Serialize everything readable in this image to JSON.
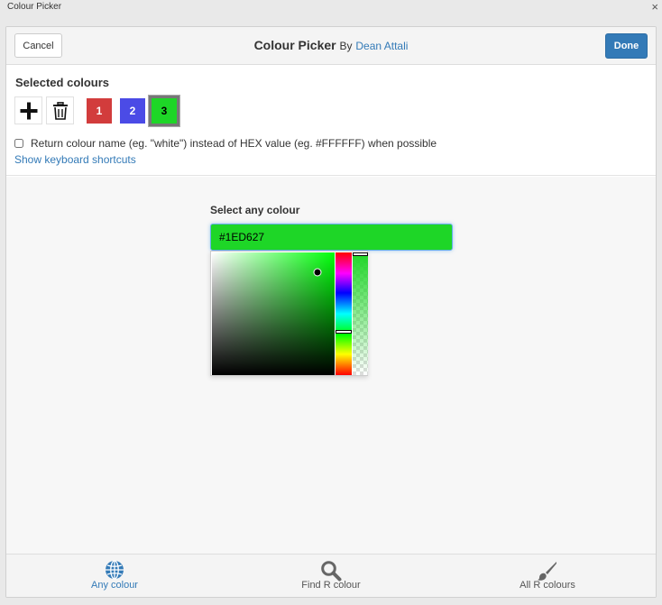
{
  "window": {
    "title": "Colour Picker",
    "close_glyph": "×"
  },
  "header": {
    "cancel_label": "Cancel",
    "title": "Colour Picker",
    "by": "By",
    "author": "Dean Attali",
    "done_label": "Done"
  },
  "selected": {
    "title": "Selected colours",
    "add_icon": "plus-icon",
    "delete_icon": "trash-icon",
    "swatches": [
      {
        "label": "1",
        "color": "#D23C3C"
      },
      {
        "label": "2",
        "color": "#4B4BE6"
      },
      {
        "label": "3",
        "color": "#1ED627"
      }
    ],
    "active_index": 2,
    "return_name_option": "Return colour name (eg. \"white\") instead of HEX value (eg. #FFFFFF) when possible",
    "return_name_checked": false,
    "shortcuts_link": "Show keyboard shortcuts"
  },
  "picker": {
    "label": "Select any colour",
    "hex_value": "#1ED627",
    "hue_color": "#00FF0A",
    "saturation": 0.86,
    "brightness": 0.84,
    "hue_level": 0.65,
    "alpha_level": 1
  },
  "tabs": [
    {
      "label": "Any colour",
      "icon": "globe-icon",
      "active": true
    },
    {
      "label": "Find R colour",
      "icon": "magnifier-icon",
      "active": false
    },
    {
      "label": "All R colours",
      "icon": "paintbrush-icon",
      "active": false
    }
  ],
  "colors": {
    "accent": "#337AB7",
    "link": "#337AB7"
  }
}
